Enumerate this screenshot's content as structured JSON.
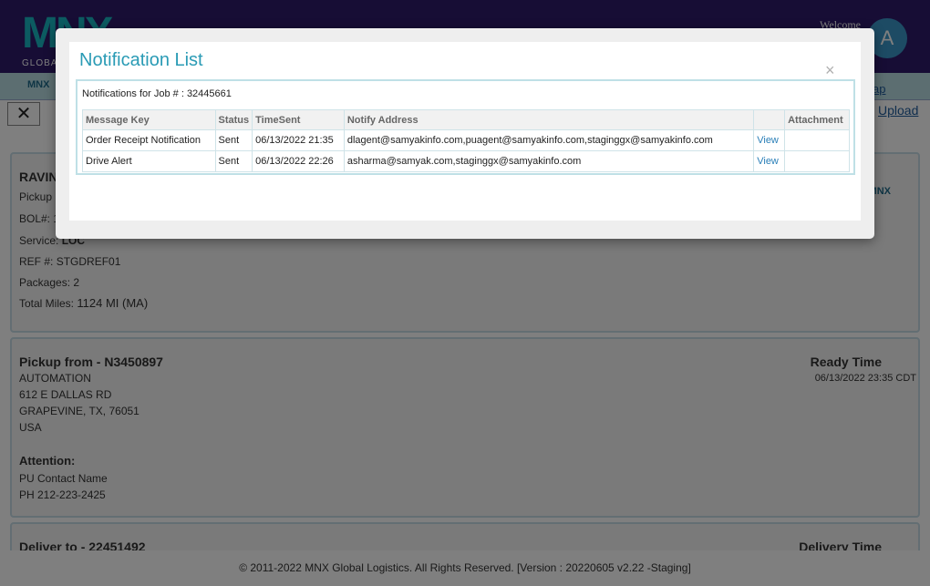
{
  "app": {
    "logo_text": "MNX",
    "logo_sub": "GLOBAL",
    "welcome": "Welcome",
    "avatar_initial": "A",
    "brand_color": "#2e1a6b",
    "accent_color": "#2a9bb5"
  },
  "subnav": {
    "mnx_label": "MNX",
    "map_link": "ap"
  },
  "toolbar": {
    "close_icon": "close-icon",
    "close_glyph": "✕",
    "upload_link": "Upload"
  },
  "job_panel": {
    "title": "RAVIN",
    "pickup_label": "Pickup",
    "bol_label": "BOL#: 1",
    "service_label": "Service:",
    "service_value": "LOC",
    "ref_label": "REF #:",
    "ref_value": "STGDREF01",
    "packages_label": "Packages:",
    "packages_value": "2",
    "miles_label": "Total Miles:",
    "miles_value": "1124 MI (MA)",
    "mnx_label": "MNX"
  },
  "pickup_panel": {
    "title": "Pickup from - N3450897",
    "company": "AUTOMATION",
    "address1": "612 E DALLAS RD",
    "city_line": "GRAPEVINE, TX, 76051",
    "country": "USA",
    "attention_label": "Attention:",
    "contact": "PU Contact Name",
    "phone": "PH  212-223-2425",
    "ready_label": "Ready Time",
    "ready_value": "06/13/2022 23:35 CDT"
  },
  "deliver_panel": {
    "title": "Deliver to - 22451492",
    "delivery_label": "Delivery Time"
  },
  "footer": {
    "text": "© 2011-2022 MNX Global Logistics. All Rights Reserved. [Version : 20220605 v2.22 -Staging]"
  },
  "modal": {
    "title": "Notification List",
    "close_glyph": "×",
    "job_label": "Notifications for Job # : 32445661",
    "columns": [
      "Message Key",
      "Status",
      "TimeSent",
      "Notify Address",
      "",
      "Attachment"
    ],
    "rows": [
      {
        "message_key": "Order Receipt Notification",
        "status": "Sent",
        "time_sent": "06/13/2022 21:35",
        "address": "dlagent@samyakinfo.com,puagent@samyakinfo.com,staginggx@samyakinfo.com",
        "view": "View",
        "attachment": ""
      },
      {
        "message_key": "Drive Alert",
        "status": "Sent",
        "time_sent": "06/13/2022 22:26",
        "address": "asharma@samyak.com,staginggx@samyakinfo.com",
        "view": "View",
        "attachment": ""
      }
    ]
  }
}
